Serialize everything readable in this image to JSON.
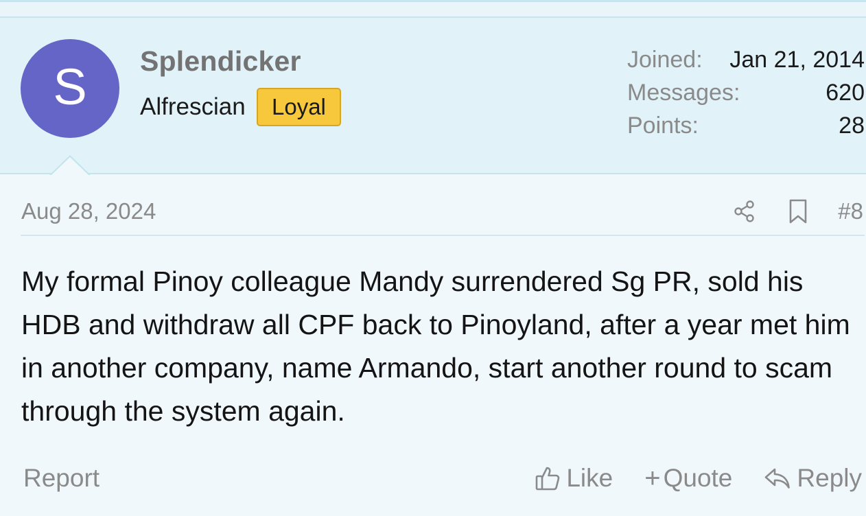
{
  "post": {
    "author": {
      "avatar_letter": "S",
      "avatar_color": "#6565c7",
      "username": "Splendicker",
      "title": "Alfrescian",
      "badge": "Loyal",
      "badge_color": "#f7c83b"
    },
    "stats": [
      {
        "key": "Joined:",
        "value": "Jan 21, 2014"
      },
      {
        "key": "Messages:",
        "value": "620"
      },
      {
        "key": "Points:",
        "value": "28"
      }
    ],
    "date": "Aug 28, 2024",
    "number": "#8",
    "body": "My formal Pinoy colleague Mandy surrendered Sg PR, sold his HDB and withdraw all CPF back to Pinoyland, after a year met him in another company, name Armando, start another round to scam through the system again.",
    "footer": {
      "report": "Report",
      "like": "Like",
      "quote_prefix": "+",
      "quote": "Quote",
      "reply": "Reply"
    },
    "icons": {
      "share": "share-icon",
      "bookmark": "bookmark-icon",
      "like": "thumbs-up-icon",
      "reply": "reply-arrow-icon"
    }
  }
}
